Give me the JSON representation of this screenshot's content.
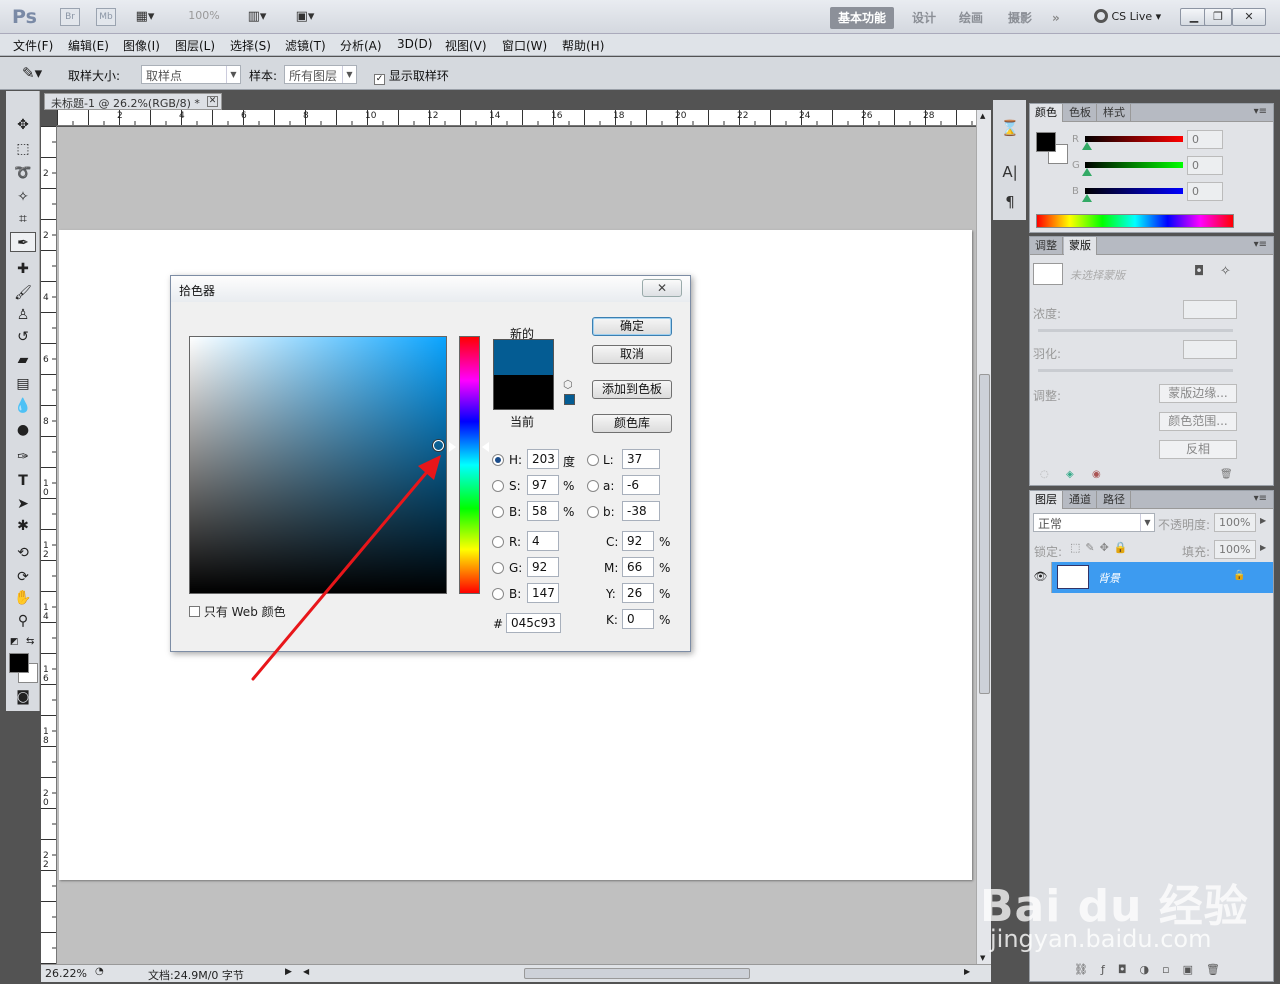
{
  "app": {
    "logo": "Ps",
    "bridge": "Br",
    "minibridge": "Mb",
    "zoom": "100%",
    "workspaces": [
      "基本功能",
      "设计",
      "绘画",
      "摄影"
    ],
    "cs_live": "CS Live"
  },
  "menu": [
    "文件(F)",
    "编辑(E)",
    "图像(I)",
    "图层(L)",
    "选择(S)",
    "滤镜(T)",
    "分析(A)",
    "3D(D)",
    "视图(V)",
    "窗口(W)",
    "帮助(H)"
  ],
  "options": {
    "sample_size_label": "取样大小:",
    "sample_size_value": "取样点",
    "sample_label": "样本:",
    "sample_value": "所有图层",
    "show_ring_label": "显示取样环"
  },
  "document": {
    "tab_title": "未标题-1 @ 26.2%(RGB/8) *",
    "ruler_h": [
      "2",
      "4",
      "6",
      "8",
      "10",
      "12",
      "14",
      "16",
      "18",
      "20",
      "22",
      "24",
      "26",
      "28"
    ],
    "ruler_v": [
      "2",
      "2",
      "4",
      "6",
      "8",
      "1\n0",
      "1\n2",
      "1\n4",
      "1\n6",
      "1\n8",
      "2\n0",
      "2\n2"
    ]
  },
  "status": {
    "zoom": "26.22%",
    "doc_info": "文档:24.9M/0 字节"
  },
  "color_picker": {
    "title": "拾色器",
    "new_label": "新的",
    "current_label": "当前",
    "new_color": "#045c93",
    "current_color": "#000000",
    "buttons": {
      "ok": "确定",
      "cancel": "取消",
      "add_swatch": "添加到色板",
      "libraries": "颜色库"
    },
    "web_only_label": "只有 Web 颜色",
    "fields": {
      "H": "203",
      "S": "97",
      "B": "58",
      "R": "4",
      "G": "92",
      "Bl": "147",
      "L": "37",
      "a": "-6",
      "b": "-38",
      "C": "92",
      "M": "66",
      "Y": "26",
      "K": "0"
    },
    "labels": {
      "H": "H:",
      "S": "S:",
      "B": "B:",
      "R": "R:",
      "G": "G:",
      "Bl": "B:",
      "L": "L:",
      "a": "a:",
      "b": "b:",
      "C": "C:",
      "M": "M:",
      "Y": "Y:",
      "K": "K:"
    },
    "units": {
      "deg": "度",
      "pct": "%"
    },
    "hex_label": "#",
    "hex": "045c93"
  },
  "color_panel": {
    "tabs": [
      "颜色",
      "色板",
      "样式"
    ],
    "r_label": "R",
    "g_label": "G",
    "b_label": "B",
    "r_value": "0",
    "g_value": "0",
    "b_value": "0"
  },
  "adjust_panel": {
    "tabs": [
      "调整",
      "蒙版"
    ],
    "no_mask": "未选择蒙版",
    "density_label": "浓度:",
    "feather_label": "羽化:",
    "refine_label": "调整:",
    "mask_edge": "蒙版边缘...",
    "color_range": "颜色范围...",
    "invert": "反相"
  },
  "layers_panel": {
    "tabs": [
      "图层",
      "通道",
      "路径"
    ],
    "blend_mode": "正常",
    "opacity_label": "不透明度:",
    "opacity_value": "100%",
    "lock_label": "锁定:",
    "fill_label": "填充:",
    "fill_value": "100%",
    "layer_name": "背景"
  },
  "watermark": {
    "brand": "Bai du 经验",
    "url": "jingyan.baidu.com"
  },
  "colors": {
    "accent_selection": "#3d9bf0",
    "arrow": "#e8161a"
  }
}
